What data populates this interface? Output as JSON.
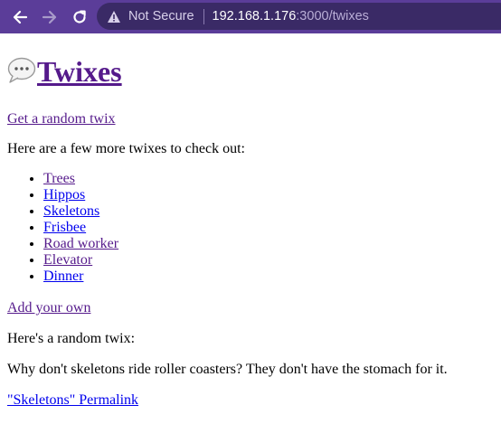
{
  "browser": {
    "security_label": "Not Secure",
    "url_host": "192.168.1.176",
    "url_rest": ":3000/twixes",
    "chrome_color": "#5b3d99"
  },
  "page": {
    "title": "Twixes",
    "title_icon": "speech-bubble-icon",
    "random_link": "Get a random twix",
    "more_intro": "Here are a few more twixes to check out:",
    "twixes": [
      {
        "label": "Trees",
        "visited": true
      },
      {
        "label": "Hippos",
        "visited": false
      },
      {
        "label": "Skeletons",
        "visited": false
      },
      {
        "label": "Frisbee",
        "visited": false
      },
      {
        "label": "Road worker",
        "visited": true
      },
      {
        "label": "Elevator",
        "visited": true
      },
      {
        "label": "Dinner",
        "visited": false
      }
    ],
    "add_link": "Add your own",
    "random_intro": "Here's a random twix:",
    "random_joke": "Why don't skeletons ride roller coasters? They don't have the stomach for it.",
    "permalink": "\"Skeletons\" Permalink"
  },
  "colors": {
    "link": "#0000ee",
    "visited_link": "#551a8b"
  }
}
